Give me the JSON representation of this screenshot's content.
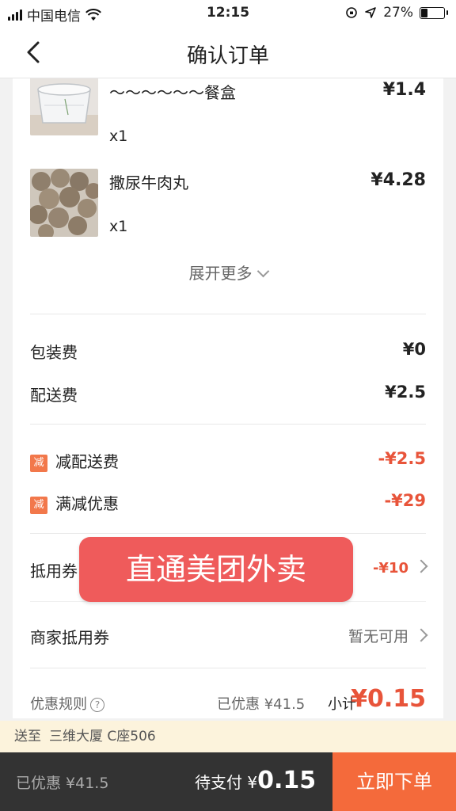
{
  "status": {
    "carrier": "中国电信",
    "time": "12:15",
    "battery": "27%",
    "battery_level": 0.27
  },
  "header": {
    "title": "确认订单",
    "back_icon": "chevron-left-icon"
  },
  "items": [
    {
      "name": "～～～～～～餐盒",
      "qty": "x1",
      "price": "¥1.4",
      "image": "plastic-container"
    },
    {
      "name": "撒尿牛肉丸",
      "qty": "x1",
      "price": "¥4.28",
      "image": "beef-balls"
    }
  ],
  "expand_label": "展开更多",
  "fees": [
    {
      "label": "包装费",
      "value": "¥0"
    },
    {
      "label": "配送费",
      "value": "¥2.5"
    }
  ],
  "discounts": [
    {
      "badge": "减",
      "label": "减配送费",
      "value": "-¥2.5"
    },
    {
      "badge": "减",
      "label": "满减优惠",
      "value": "-¥29"
    }
  ],
  "coupons": [
    {
      "label": "抵用券",
      "value": "-¥10"
    },
    {
      "label": "商家抵用券",
      "value": "暂无可用"
    }
  ],
  "summary": {
    "rules": "优惠规则",
    "discounted": "已优惠 ¥41.5",
    "subtotal_label": "小计",
    "subtotal": "¥0.15"
  },
  "banner": "直通美团外卖",
  "address": {
    "prefix": "送至",
    "text": "三维大厦 C座506"
  },
  "bottom": {
    "saved": "已优惠 ¥41.5",
    "pay_label": "待支付 ¥",
    "pay_amount": "0.15",
    "order_button": "立即下单"
  },
  "colors": {
    "accent": "#f46a3b",
    "discount_red": "#e8543a",
    "banner": "#ef5b5b"
  }
}
